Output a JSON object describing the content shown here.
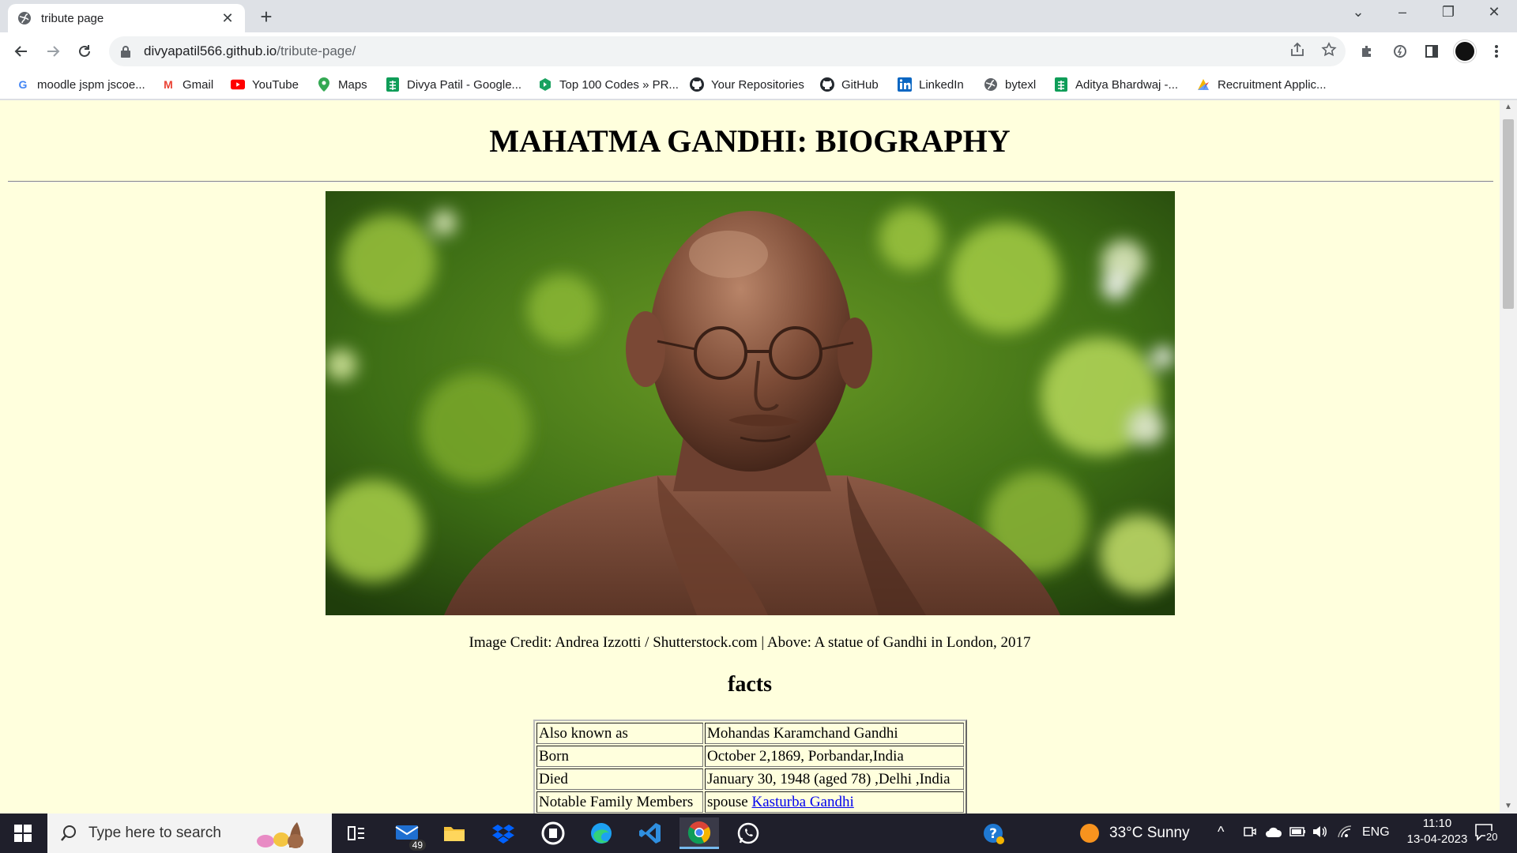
{
  "browser": {
    "tab_title": "tribute page",
    "url_host": "divyapatil566.github.io",
    "url_path": "/tribute-page/"
  },
  "bookmarks": [
    {
      "label": "moodle jspm jscoe...",
      "icon": "google-icon"
    },
    {
      "label": "Gmail",
      "icon": "gmail-icon"
    },
    {
      "label": "YouTube",
      "icon": "youtube-icon"
    },
    {
      "label": "Maps",
      "icon": "maps-icon"
    },
    {
      "label": "Divya Patil - Google...",
      "icon": "sheets-icon"
    },
    {
      "label": "Top 100 Codes » PR...",
      "icon": "codes-icon"
    },
    {
      "label": "Your Repositories",
      "icon": "github-icon"
    },
    {
      "label": "GitHub",
      "icon": "github-icon"
    },
    {
      "label": "LinkedIn",
      "icon": "linkedin-icon"
    },
    {
      "label": "bytexl",
      "icon": "globe-icon"
    },
    {
      "label": "Aditya Bhardwaj -...",
      "icon": "sheets-icon"
    },
    {
      "label": "Recruitment Applic...",
      "icon": "recruit-icon"
    }
  ],
  "page": {
    "title": "MAHATMA GANDHI: BIOGRAPHY",
    "caption": "Image Credit: Andrea Izzotti / Shutterstock.com | Above: A statue of Gandhi in London, 2017",
    "facts_heading": "facts",
    "facts": [
      {
        "key": "Also known as",
        "value": "Mohandas Karamchand Gandhi"
      },
      {
        "key": "Born",
        "value": "October 2,1869, Porbandar,India"
      },
      {
        "key": "Died",
        "value": "January 30, 1948 (aged 78) ,Delhi ,India"
      },
      {
        "key": "Notable Family Members",
        "value_prefix": "spouse ",
        "value_link": "Kasturba Gandhi"
      }
    ],
    "background_color": "#ffffdd"
  },
  "taskbar": {
    "search_placeholder": "Type here to search",
    "mail_badge": "49",
    "weather": "33°C  Sunny",
    "language": "ENG",
    "time": "11:10",
    "date": "13-04-2023",
    "notifications": "20"
  }
}
